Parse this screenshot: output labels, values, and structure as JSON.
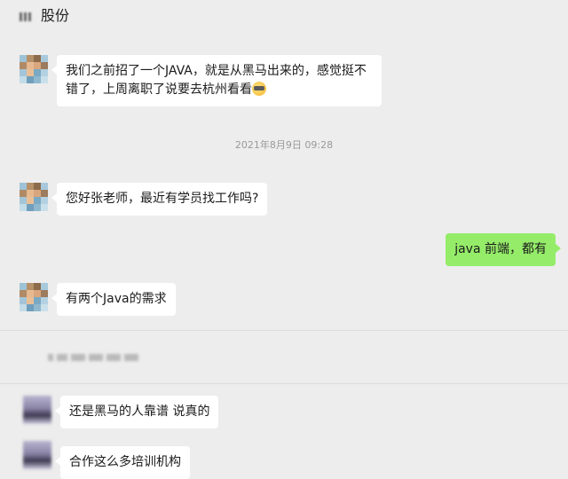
{
  "header": {
    "title": "股份"
  },
  "messages": [
    {
      "id": "m1",
      "side": "left",
      "lines": [
        "我们之前招了一个JAVA，就是从黑马出来的，感觉挺不",
        "错了，上周离职了说要去杭州看看"
      ],
      "emoji": "sweat-smile-emoji"
    },
    {
      "id": "m2",
      "side": "left",
      "text": "您好张老师，最近有学员找工作吗?"
    },
    {
      "id": "m3",
      "side": "right",
      "text": "java 前端，都有"
    },
    {
      "id": "m4",
      "side": "left",
      "text": "有两个Java的需求"
    },
    {
      "id": "m5",
      "side": "left",
      "text": "还是黑马的人靠谱  说真的"
    },
    {
      "id": "m6",
      "side": "left",
      "text": "合作这么多培训机构"
    }
  ],
  "timestamp": "2021年8月9日 09:28",
  "colors": {
    "background": "#ededed",
    "bubble_in": "#ffffff",
    "bubble_out": "#95ec69"
  }
}
